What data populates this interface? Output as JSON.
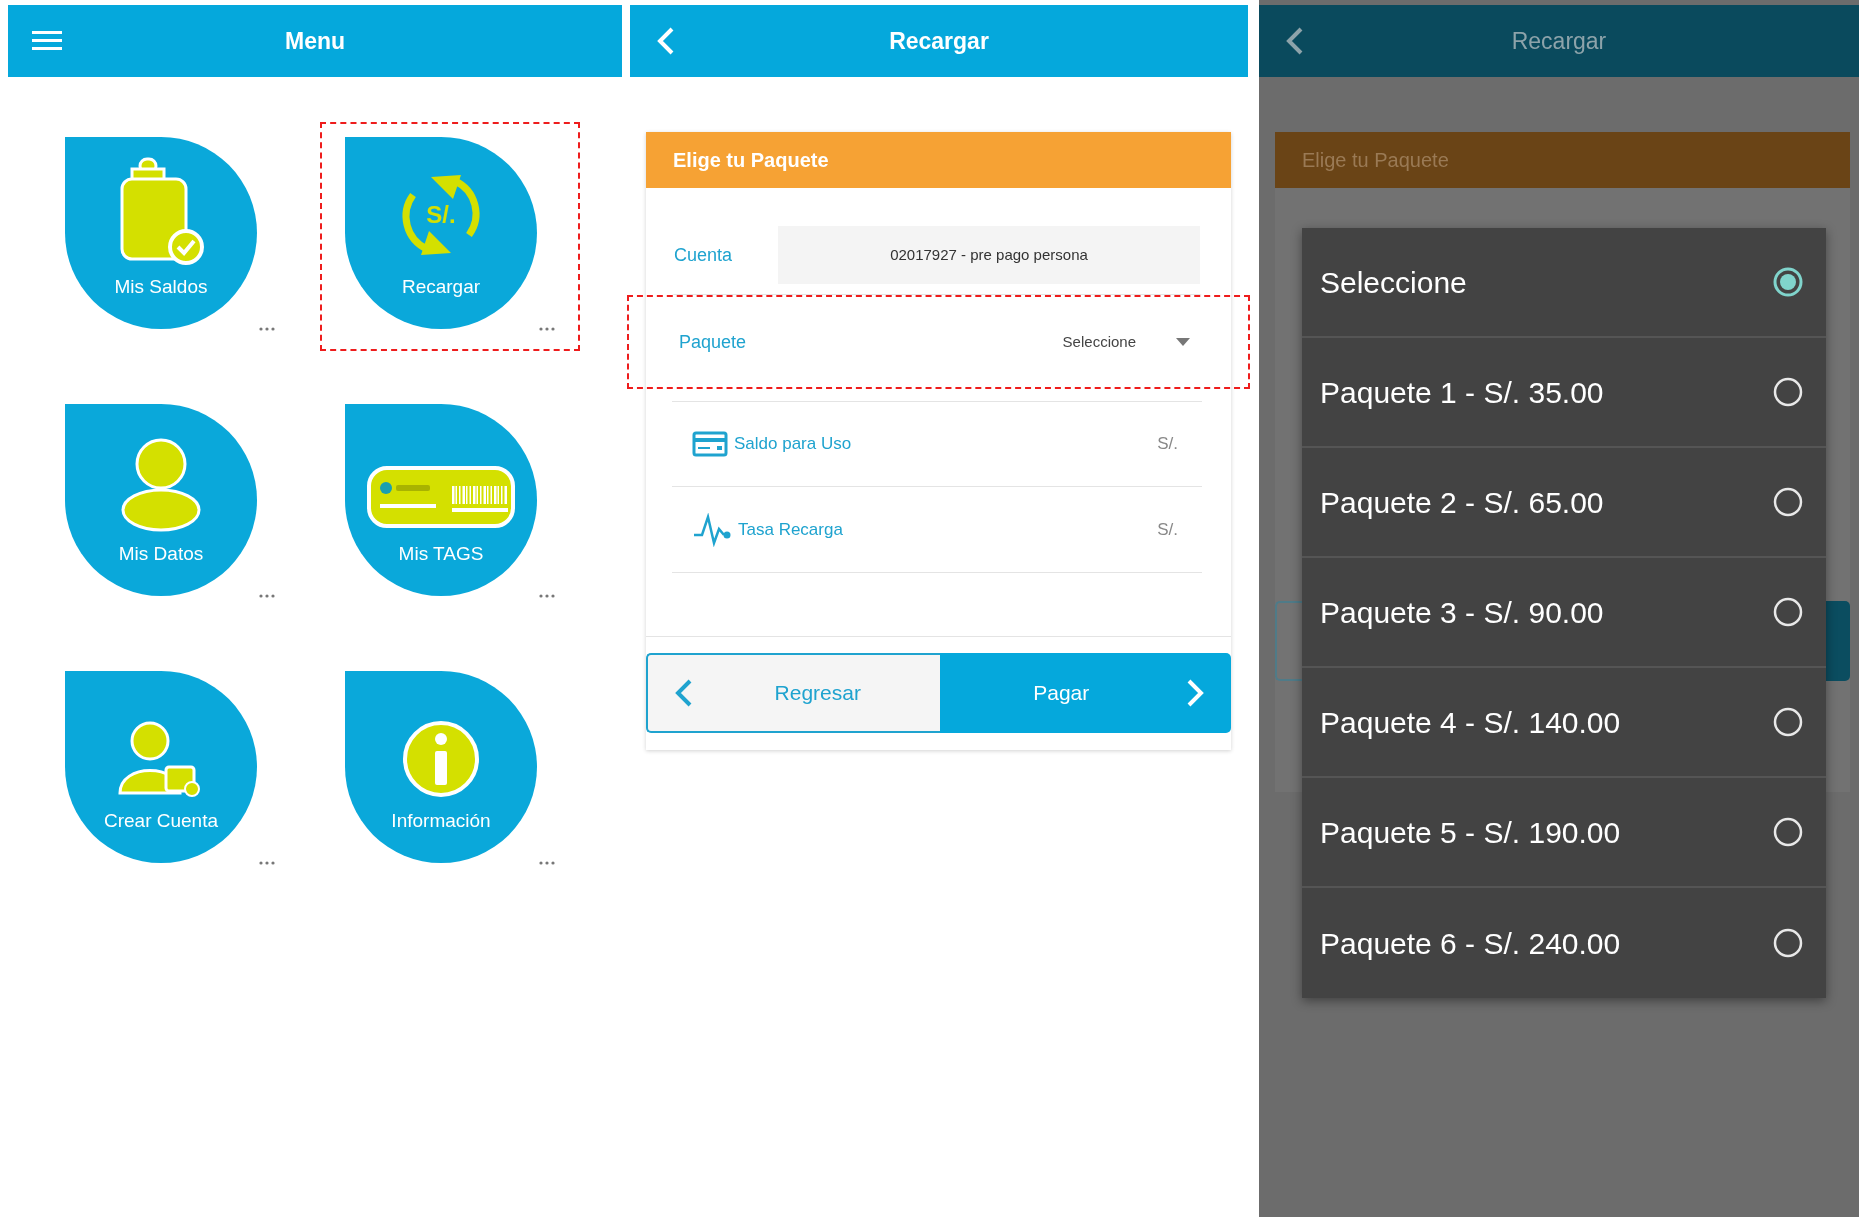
{
  "menu_screen": {
    "title": "Menu",
    "recharge_icon_text": "S/.",
    "tiles": [
      {
        "kind": "balance",
        "label": "Mis Saldos",
        "highlighted": false
      },
      {
        "kind": "recharge",
        "label": "Recargar",
        "highlighted": true
      },
      {
        "kind": "profile",
        "label": "Mis Datos",
        "highlighted": false
      },
      {
        "kind": "tags",
        "label": "Mis TAGS",
        "highlighted": false
      },
      {
        "kind": "new_account",
        "label": "Crear Cuenta",
        "highlighted": false
      },
      {
        "kind": "info",
        "label": "Información",
        "highlighted": false
      }
    ]
  },
  "recharge_screen": {
    "title": "Recargar",
    "card_title": "Elige tu Paquete",
    "fields": [
      {
        "kind": "account",
        "label": "Cuenta",
        "value": "02017927 - pre pago persona",
        "highlighted": false
      },
      {
        "kind": "select",
        "label": "Paquete",
        "value": "Seleccione",
        "highlighted": true
      }
    ],
    "amounts": [
      {
        "kind": "balance",
        "label": "Saldo para Uso",
        "value": "S/."
      },
      {
        "kind": "fee",
        "label": "Tasa Recarga",
        "value": "S/."
      }
    ],
    "buttons": [
      {
        "kind": "back",
        "label": "Regresar"
      },
      {
        "kind": "next",
        "label": "Pagar"
      }
    ]
  },
  "picker_screen": {
    "title": "Recargar",
    "card_title": "Elige tu Paquete",
    "options": [
      {
        "label": "Seleccione",
        "selected": true
      },
      {
        "label": "Paquete 1 - S/. 35.00",
        "selected": false
      },
      {
        "label": "Paquete 2 - S/. 65.00",
        "selected": false
      },
      {
        "label": "Paquete 3 - S/. 90.00",
        "selected": false
      },
      {
        "label": "Paquete 4 - S/. 140.00",
        "selected": false
      },
      {
        "label": "Paquete 5 - S/. 190.00",
        "selected": false
      },
      {
        "label": "Paquete 6 - S/. 240.00",
        "selected": false
      }
    ]
  }
}
